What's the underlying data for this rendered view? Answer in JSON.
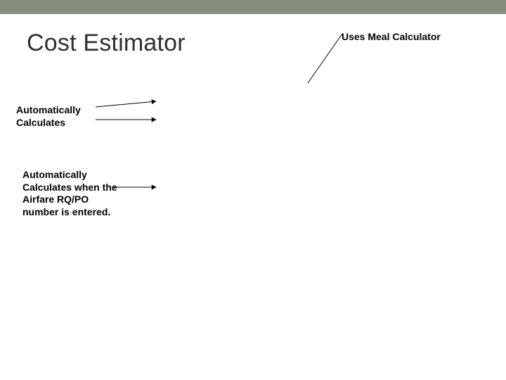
{
  "title": "Cost Estimator",
  "annotations": {
    "auto_calculates": "Automatically Calculates",
    "auto_calculates_airfare": "Automatically Calculates when the Airfare RQ/PO number is entered.",
    "uses_meal_calculator": "Uses Meal Calculator"
  }
}
